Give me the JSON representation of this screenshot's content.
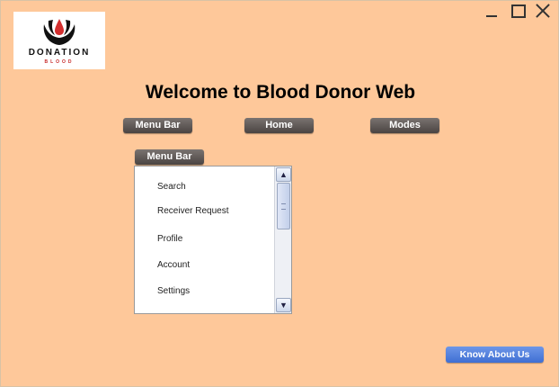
{
  "logo": {
    "word": "DONATION",
    "sub": "BLOOD"
  },
  "page": {
    "title": "Welcome to Blood Donor Web"
  },
  "nav": {
    "menu_bar_label": "Menu Bar",
    "home_label": "Home",
    "modes_label": "Modes"
  },
  "dropdown": {
    "label": "Menu Bar",
    "items": [
      "Search",
      "Receiver Request",
      "Profile",
      "Account",
      "Settings"
    ]
  },
  "footer": {
    "know_about_label": "Know About Us"
  },
  "colors": {
    "background": "#fec89a",
    "button": "#5a5350",
    "accent_button": "#4a78d8",
    "logo_red": "#c62828"
  },
  "icons": {
    "minimize": "minimize-icon",
    "maximize": "maximize-icon",
    "close": "close-icon",
    "scroll_up": "chevron-up-icon",
    "scroll_down": "chevron-down-icon"
  }
}
